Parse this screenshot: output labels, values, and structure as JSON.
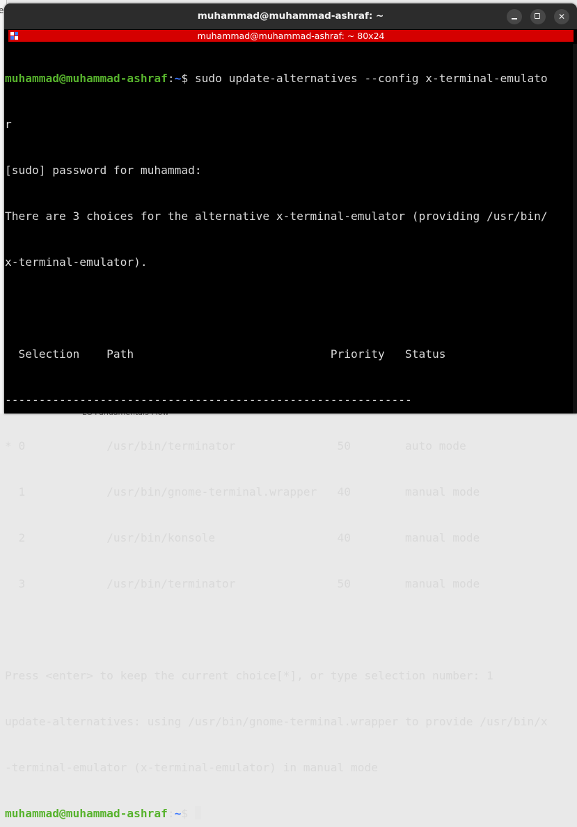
{
  "background": {
    "left_text": "ec",
    "bottom_text": "LG Fundamentals Flow",
    "desktop_bg": "#e9e9e9"
  },
  "window": {
    "title": "muhammad@muhammad-ashraf: ~",
    "buttons": {
      "minimize": "minimize",
      "maximize": "maximize",
      "close": "✕"
    }
  },
  "tab": {
    "title": "muhammad@muhammad-ashraf: ~ 80x24",
    "color": "#d50000"
  },
  "terminal": {
    "prompt_user": "muhammad@muhammad-ashraf",
    "prompt_sep": ":",
    "prompt_path": "~",
    "prompt_end": "$ ",
    "command": "sudo update-alternatives --config x-terminal-emulato",
    "command_wrap": "r",
    "lines": [
      "[sudo] password for muhammad:",
      "There are 3 choices for the alternative x-terminal-emulator (providing /usr/bin/",
      "x-terminal-emulator).",
      "",
      "  Selection    Path                             Priority   Status",
      "------------------------------------------------------------",
      "* 0            /usr/bin/terminator               50        auto mode",
      "  1            /usr/bin/gnome-terminal.wrapper   40        manual mode",
      "  2            /usr/bin/konsole                  40        manual mode",
      "  3            /usr/bin/terminator               50        manual mode",
      "",
      "Press <enter> to keep the current choice[*], or type selection number: 1",
      "update-alternatives: using /usr/bin/gnome-terminal.wrapper to provide /usr/bin/x",
      "-terminal-emulator (x-terminal-emulator) in manual mode"
    ],
    "colors": {
      "user": "#57b32d",
      "path": "#3b78ff",
      "text": "#d9d9d9"
    }
  }
}
